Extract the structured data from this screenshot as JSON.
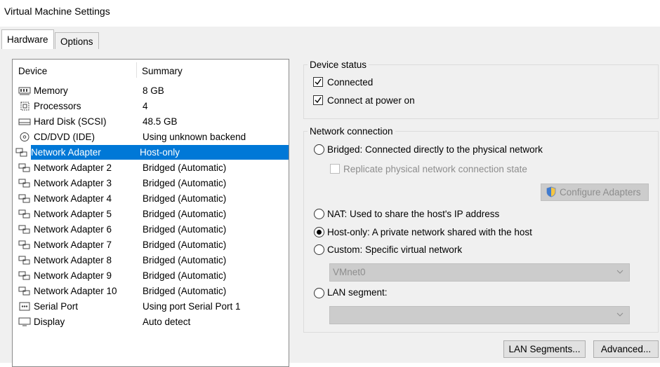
{
  "window": {
    "title": "Virtual Machine Settings"
  },
  "tabs": [
    {
      "label": "Hardware",
      "active": true
    },
    {
      "label": "Options",
      "active": false
    }
  ],
  "device_list": {
    "columns": {
      "device": "Device",
      "summary": "Summary"
    },
    "rows": [
      {
        "device": "Memory",
        "summary": "8 GB",
        "icon": "memory-icon"
      },
      {
        "device": "Processors",
        "summary": "4",
        "icon": "processor-icon"
      },
      {
        "device": "Hard Disk (SCSI)",
        "summary": "48.5 GB",
        "icon": "hard-disk-icon"
      },
      {
        "device": "CD/DVD (IDE)",
        "summary": "Using unknown backend",
        "icon": "cd-dvd-icon"
      },
      {
        "device": "Network Adapter",
        "summary": "Host-only",
        "icon": "network-adapter-icon",
        "selected": true
      },
      {
        "device": "Network Adapter 2",
        "summary": "Bridged (Automatic)",
        "icon": "network-adapter-icon"
      },
      {
        "device": "Network Adapter 3",
        "summary": "Bridged (Automatic)",
        "icon": "network-adapter-icon"
      },
      {
        "device": "Network Adapter 4",
        "summary": "Bridged (Automatic)",
        "icon": "network-adapter-icon"
      },
      {
        "device": "Network Adapter 5",
        "summary": "Bridged (Automatic)",
        "icon": "network-adapter-icon"
      },
      {
        "device": "Network Adapter 6",
        "summary": "Bridged (Automatic)",
        "icon": "network-adapter-icon"
      },
      {
        "device": "Network Adapter 7",
        "summary": "Bridged (Automatic)",
        "icon": "network-adapter-icon"
      },
      {
        "device": "Network Adapter 8",
        "summary": "Bridged (Automatic)",
        "icon": "network-adapter-icon"
      },
      {
        "device": "Network Adapter 9",
        "summary": "Bridged (Automatic)",
        "icon": "network-adapter-icon"
      },
      {
        "device": "Network Adapter 10",
        "summary": "Bridged (Automatic)",
        "icon": "network-adapter-icon"
      },
      {
        "device": "Serial Port",
        "summary": "Using port Serial Port 1",
        "icon": "serial-port-icon"
      },
      {
        "device": "Display",
        "summary": "Auto detect",
        "icon": "display-icon"
      }
    ]
  },
  "device_status": {
    "legend": "Device status",
    "connected": {
      "label": "Connected",
      "checked": true
    },
    "connect_at_power_on": {
      "label": "Connect at power on",
      "checked": true
    }
  },
  "network_connection": {
    "legend": "Network connection",
    "bridged": {
      "label": "Bridged: Connected directly to the physical network",
      "selected": false
    },
    "replicate": {
      "label": "Replicate physical network connection state",
      "checked": false,
      "disabled": true
    },
    "configure_adapters": {
      "label": "Configure Adapters",
      "disabled": true
    },
    "nat": {
      "label": "NAT: Used to share the host's IP address",
      "selected": false
    },
    "host_only": {
      "label": "Host-only: A private network shared with the host",
      "selected": true
    },
    "custom": {
      "label": "Custom: Specific virtual network",
      "selected": false
    },
    "custom_select": {
      "value": "VMnet0",
      "disabled": true
    },
    "lan_segment": {
      "label": "LAN segment:",
      "selected": false
    },
    "lan_segment_select": {
      "value": "",
      "disabled": true
    }
  },
  "buttons": {
    "lan_segments": "LAN Segments...",
    "advanced": "Advanced..."
  },
  "colors": {
    "selection": "#0078d7",
    "panel_bg": "#f0f0f0"
  }
}
